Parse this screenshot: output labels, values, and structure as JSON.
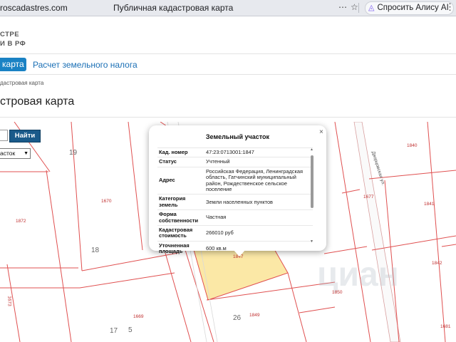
{
  "browser": {
    "url": "roscadastres.com",
    "page_title": "Публичная кадастровая карта",
    "alice_label": "Спросить Алису AI"
  },
  "header": {
    "logo_line1": "СТРЕ",
    "logo_line2": "И В РФ"
  },
  "nav": {
    "active_tab": "карта",
    "tab_tax": "Расчет земельного налога"
  },
  "breadcrumb": "дастровая карта",
  "page_title": "стровая карта",
  "map_controls": {
    "find_label": "Найти",
    "select_value": "асток"
  },
  "parcel_labels": [
    "19",
    "18",
    "17",
    "5",
    "26",
    "1670",
    "1872",
    "1669",
    "1849",
    "1850",
    "1840",
    "1841",
    "1842",
    "1681",
    "1677",
    "1847",
    "1673"
  ],
  "road_label": "Дворцовская ул.",
  "watermark": "циан",
  "popup": {
    "title": "Земельный участок",
    "rows": [
      {
        "key": "Кад. номер",
        "value": "47:23:0713001:1847"
      },
      {
        "key": "Статус",
        "value": "Учтенный"
      },
      {
        "key": "Адрес",
        "value": "Российская Федерация, Ленинградская область, Гатчинский муниципальный район, Рождественское сельское поселение"
      },
      {
        "key": "Категория земель",
        "value": "Земли населенных пунктов"
      },
      {
        "key": "Форма собственности",
        "value": "Частная"
      },
      {
        "key": "Кадастровая стоимость",
        "value": "266010 руб"
      },
      {
        "key": "Уточненная площадь",
        "value": "600 кв.м"
      }
    ]
  },
  "colors": {
    "accent": "#1a82c4",
    "parcel_line": "#e05050",
    "selected_parcel": "#fbe8a6"
  }
}
